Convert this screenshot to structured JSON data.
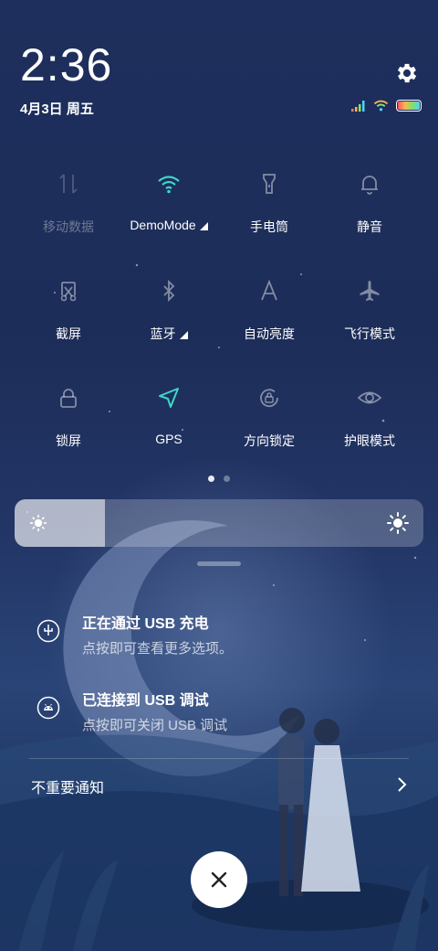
{
  "status": {
    "time": "2:36",
    "date": "4月3日 周五"
  },
  "tiles": [
    {
      "label": "移动数据",
      "icon": "mobile-data-icon",
      "active": false
    },
    {
      "label": "DemoMode",
      "icon": "wifi-icon",
      "active": true
    },
    {
      "label": "手电筒",
      "icon": "flashlight-icon",
      "active": false
    },
    {
      "label": "静音",
      "icon": "bell-icon",
      "active": false
    },
    {
      "label": "截屏",
      "icon": "screenshot-icon",
      "active": false
    },
    {
      "label": "蓝牙",
      "icon": "bluetooth-icon",
      "active": false
    },
    {
      "label": "自动亮度",
      "icon": "auto-brightness-icon",
      "active": false
    },
    {
      "label": "飞行模式",
      "icon": "airplane-icon",
      "active": false
    },
    {
      "label": "锁屏",
      "icon": "lock-icon",
      "active": false
    },
    {
      "label": "GPS",
      "icon": "gps-icon",
      "active": true
    },
    {
      "label": "方向锁定",
      "icon": "rotation-lock-icon",
      "active": false
    },
    {
      "label": "护眼模式",
      "icon": "eye-icon",
      "active": false
    }
  ],
  "pager": {
    "count": 2,
    "current": 0
  },
  "brightness": {
    "level": 0.22
  },
  "notifications": [
    {
      "title": "正在通过 USB 充电",
      "subtitle": "点按即可查看更多选项。",
      "icon": "usb-charging-icon"
    },
    {
      "title": "已连接到 USB 调试",
      "subtitle": "点按即可关闭 USB 调试",
      "icon": "android-debug-icon"
    }
  ],
  "unimportant": {
    "label": "不重要通知"
  },
  "colors": {
    "accent": "#3fd6c6",
    "background": "#1e2f5d"
  }
}
